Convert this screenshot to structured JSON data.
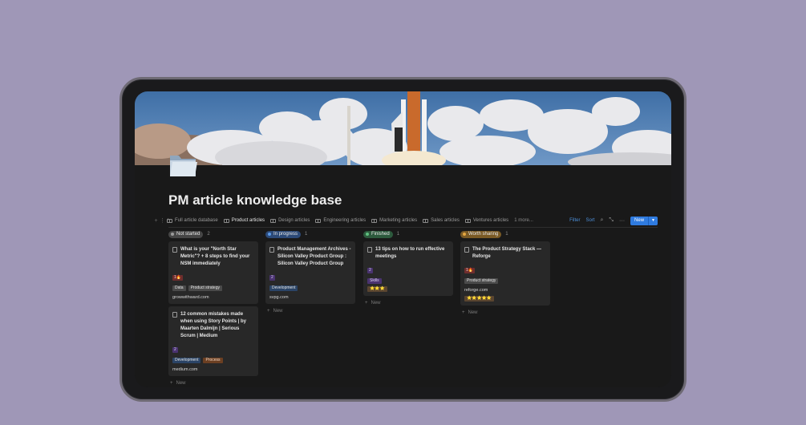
{
  "page": {
    "title": "PM article knowledge base",
    "icon": "folder-icon"
  },
  "tabs": [
    {
      "label": "Full article database",
      "icon": "table-icon"
    },
    {
      "label": "Product articles",
      "icon": "board-icon"
    },
    {
      "label": "Design articles",
      "icon": "board-icon"
    },
    {
      "label": "Engineering articles",
      "icon": "board-icon"
    },
    {
      "label": "Marketing articles",
      "icon": "board-icon"
    },
    {
      "label": "Sales articles",
      "icon": "board-icon"
    },
    {
      "label": "Ventures articles",
      "icon": "board-icon"
    },
    {
      "label": "1 more..."
    }
  ],
  "toolbar": {
    "filter_label": "Filter",
    "sort_label": "Sort",
    "new_label": "New"
  },
  "columns": [
    {
      "status": "Not started",
      "count": "2",
      "color": "#5a5a5a",
      "dot": "#9b9b9b",
      "cards": [
        {
          "title": "What is your \"North Star Metric\"? + 8 steps to find your NSM immediately",
          "badge": "1🔥",
          "tags": [
            "Data",
            "Product strategy"
          ],
          "url": "growwithward.com"
        },
        {
          "title": "12 common mistakes made when using Story Points | by Maarten Dalmijn | Serious Scrum | Medium",
          "badge": "2",
          "tags": [
            "Development",
            "Process"
          ],
          "url": "medium.com"
        }
      ],
      "new_label": "New"
    },
    {
      "status": "In progress",
      "count": "1",
      "color": "#2c4a78",
      "dot": "#5b9ae8",
      "cards": [
        {
          "title": "Product Management Archives - Silicon Valley Product Group : Silicon Valley Product Group",
          "badge": "2",
          "tags": [
            "Development"
          ],
          "url": "svpg.com"
        }
      ],
      "new_label": "New"
    },
    {
      "status": "Finished",
      "count": "1",
      "color": "#2d5a3d",
      "dot": "#5fbf7f",
      "cards": [
        {
          "title": "13 tips on how to run effective meetings",
          "badge": "2",
          "tags": [
            "Skills",
            "⭐⭐⭐"
          ]
        }
      ],
      "new_label": "New"
    },
    {
      "status": "Worth sharing",
      "count": "1",
      "color": "#7a5a25",
      "dot": "#e2a640",
      "cards": [
        {
          "title": "The Product Strategy Stack — Reforge",
          "badge": "1🔥",
          "tags": [
            "Product strategy"
          ],
          "url": "reforge.com",
          "rating": "⭐⭐⭐⭐⭐"
        }
      ],
      "new_label": "New"
    }
  ]
}
